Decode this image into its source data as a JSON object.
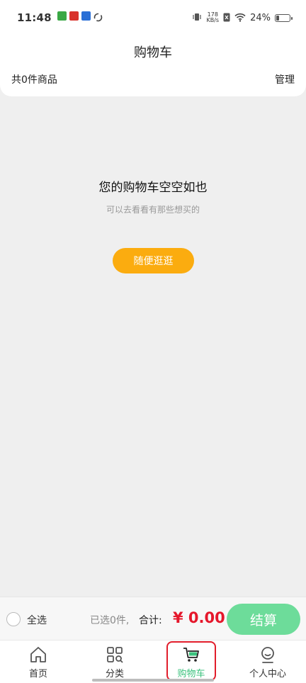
{
  "status_bar": {
    "time": "11:48",
    "net_speed_value": "178",
    "net_speed_unit": "KB/s",
    "battery_percent": "24%",
    "battery_level": 0.24
  },
  "header": {
    "title": "购物车",
    "item_count_text": "共0件商品",
    "manage_label": "管理"
  },
  "empty_state": {
    "title": "您的购物车空空如也",
    "subtitle": "可以去看看有那些想买的",
    "browse_button": "随便逛逛"
  },
  "checkout_bar": {
    "select_all_label": "全选",
    "selected_text": "已选0件,",
    "total_label": "合计:",
    "total_amount": "¥ 0.00",
    "checkout_button": "结算"
  },
  "tabs": [
    {
      "label": "首页",
      "icon": "home-icon",
      "active": false
    },
    {
      "label": "分类",
      "icon": "category-icon",
      "active": false
    },
    {
      "label": "购物车",
      "icon": "cart-icon",
      "active": true
    },
    {
      "label": "个人中心",
      "icon": "profile-icon",
      "active": false
    }
  ],
  "colors": {
    "accent_green": "#3bc27d",
    "browse_button": "#fbac0f",
    "price_red": "#e5172b",
    "highlight_red": "#e11d2b"
  }
}
